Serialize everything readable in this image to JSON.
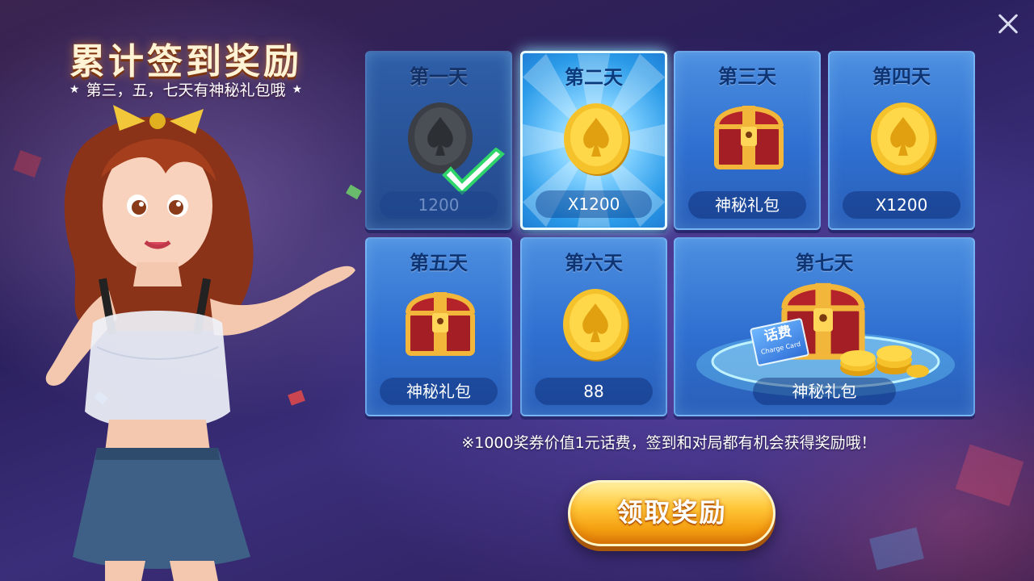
{
  "header": {
    "title": "累计签到奖励",
    "subtitle": "第三，五，七天有神秘礼包哦",
    "star_left": "★",
    "star_right": "★"
  },
  "close_icon": "close-icon",
  "days": [
    {
      "label": "第一天",
      "reward": "1200",
      "icon": "coin-icon",
      "state": "claimed"
    },
    {
      "label": "第二天",
      "reward": "X1200",
      "icon": "coin-icon",
      "state": "today"
    },
    {
      "label": "第三天",
      "reward": "神秘礼包",
      "icon": "treasure-chest-icon",
      "state": "locked"
    },
    {
      "label": "第四天",
      "reward": "X1200",
      "icon": "coin-icon",
      "state": "locked"
    },
    {
      "label": "第五天",
      "reward": "神秘礼包",
      "icon": "treasure-chest-icon",
      "state": "locked"
    },
    {
      "label": "第六天",
      "reward": "88",
      "icon": "coin-icon",
      "state": "locked"
    },
    {
      "label": "第七天",
      "reward": "神秘礼包",
      "icon": "treasure-chest-icon",
      "state": "locked"
    }
  ],
  "phone_card_text": "话费",
  "phone_card_subtext": "Charge Card",
  "note": "※1000奖券价值1元话费，签到和对局都有机会获得奖励哦！",
  "claim_button": {
    "label": "领取奖励"
  },
  "colors": {
    "card_blue": "#3a7fdc",
    "button_gold": "#ffc83a",
    "title_cream": "#fff3d6"
  }
}
